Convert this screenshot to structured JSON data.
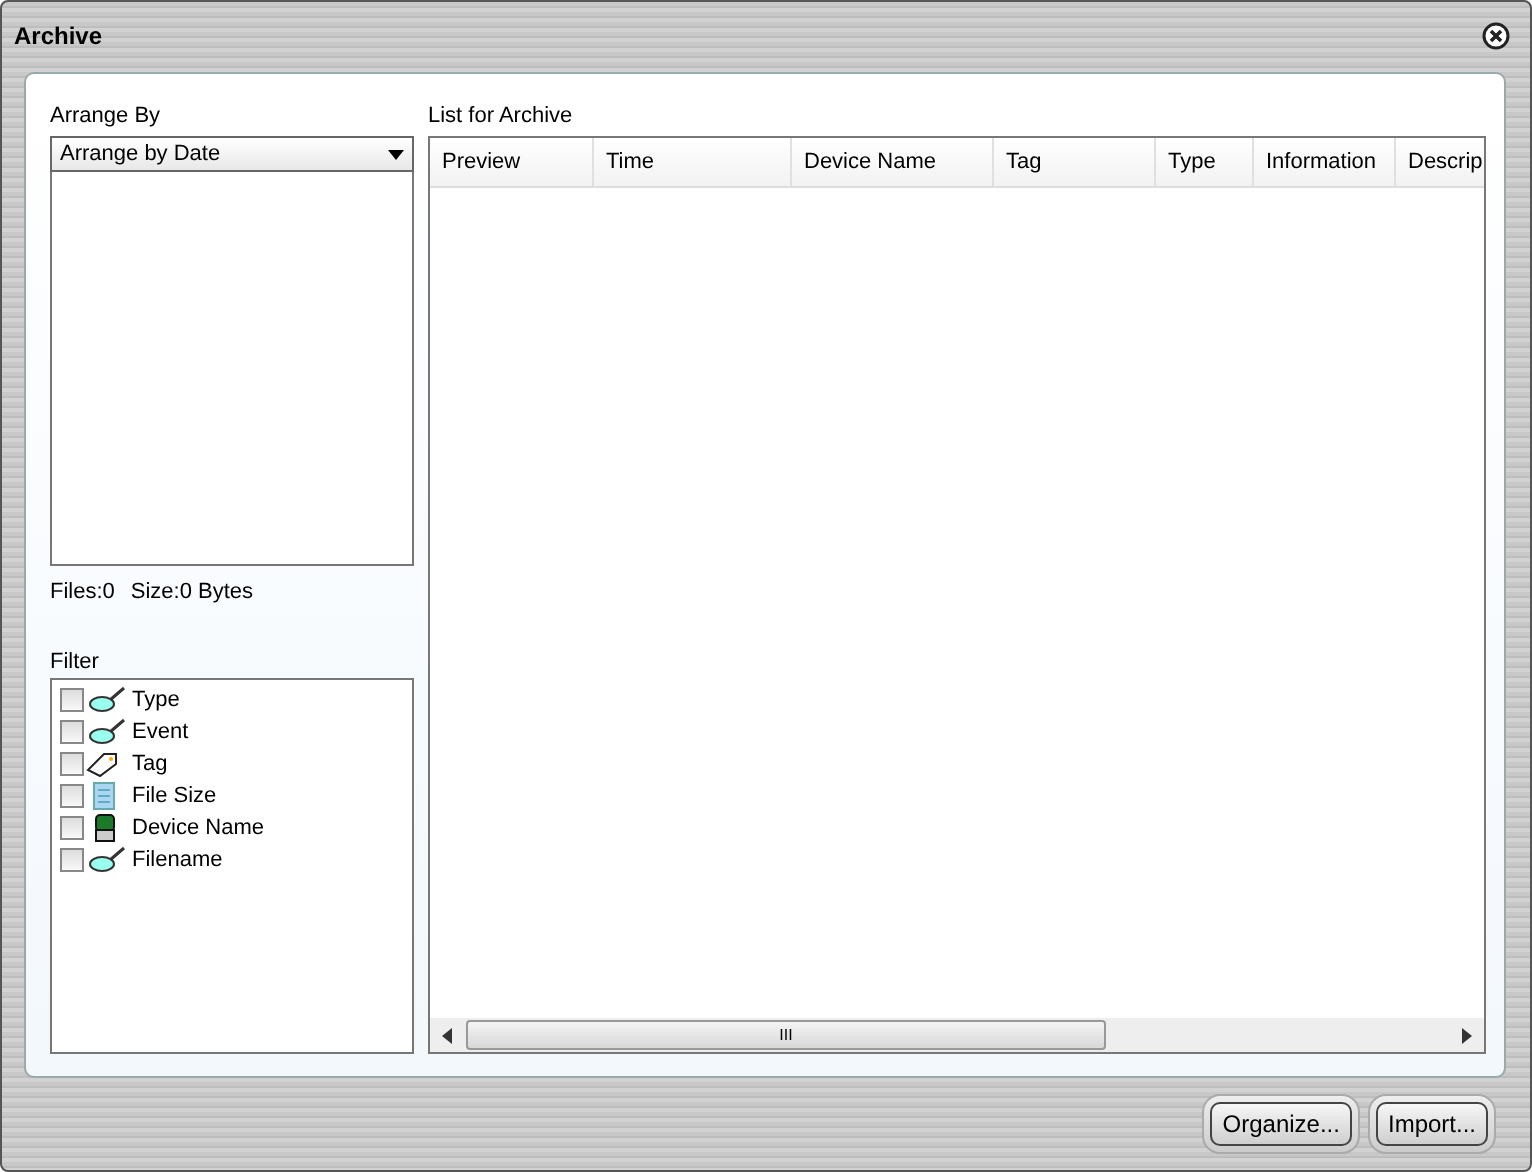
{
  "window": {
    "title": "Archive"
  },
  "arrange": {
    "label": "Arrange By",
    "value": "Arrange by Date"
  },
  "summary": {
    "files": "Files:0",
    "size": "Size:0 Bytes"
  },
  "filter": {
    "label": "Filter",
    "items": [
      {
        "label": "Type",
        "kind": "magnifier",
        "checked": false
      },
      {
        "label": "Event",
        "kind": "magnifier",
        "checked": false
      },
      {
        "label": "Tag",
        "kind": "tag",
        "checked": false
      },
      {
        "label": "File Size",
        "kind": "document",
        "checked": false
      },
      {
        "label": "Device Name",
        "kind": "device",
        "checked": false
      },
      {
        "label": "Filename",
        "kind": "magnifier",
        "checked": false
      }
    ]
  },
  "list": {
    "label": "List for Archive",
    "columns": [
      "Preview",
      "Time",
      "Device Name",
      "Tag",
      "Type",
      "Information",
      "Descrip"
    ],
    "scroll_grip": "III"
  },
  "buttons": [
    "Organize...",
    "Import..."
  ]
}
